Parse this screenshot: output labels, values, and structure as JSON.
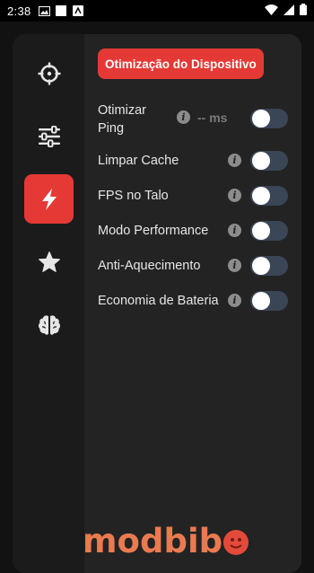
{
  "statusbar": {
    "time": "2:38"
  },
  "sidebar": {
    "items": [
      {
        "icon": "crosshair-icon",
        "active": false
      },
      {
        "icon": "sliders-icon",
        "active": false
      },
      {
        "icon": "lightning-bolt-icon",
        "active": true
      },
      {
        "icon": "star-icon",
        "active": false
      },
      {
        "icon": "brain-icon",
        "active": false
      }
    ]
  },
  "header": {
    "title": "Otimização do Dispositivo"
  },
  "settings": [
    {
      "label": "Otimizar\nPing",
      "label_line1": "Otimizar",
      "label_line2": "Ping",
      "extra": "-- ms",
      "enabled": false
    },
    {
      "label": "Limpar Cache",
      "enabled": false
    },
    {
      "label": "FPS no Talo",
      "enabled": false
    },
    {
      "label": "Modo Performance",
      "enabled": false
    },
    {
      "label": "Anti-Aquecimento",
      "enabled": false
    },
    {
      "label": "Economia de Bateria",
      "enabled": false
    }
  ],
  "watermark": {
    "text": "modbib"
  },
  "colors": {
    "accent": "#e53935",
    "toggle_track": "#3a4556",
    "panel": "#232323",
    "sidebar": "#1b1b1b"
  }
}
